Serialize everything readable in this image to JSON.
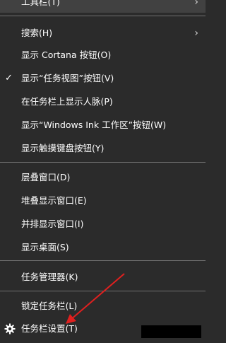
{
  "menu": {
    "items": [
      {
        "label": "工具栏(T)",
        "submenu": true
      },
      {
        "label": "搜索(H)",
        "submenu": true
      },
      {
        "label": "显示 Cortana 按钮(O)"
      },
      {
        "label": "显示“任务视图”按钮(V)",
        "checked": true
      },
      {
        "label": "在任务栏上显示人脉(P)"
      },
      {
        "label": "显示“Windows Ink 工作区”按钮(W)"
      },
      {
        "label": "显示触摸键盘按钮(Y)"
      },
      {
        "label": "层叠窗口(D)"
      },
      {
        "label": "堆叠显示窗口(E)"
      },
      {
        "label": "并排显示窗口(I)"
      },
      {
        "label": "显示桌面(S)"
      },
      {
        "label": "任务管理器(K)"
      },
      {
        "label": "锁定任务栏(L)"
      },
      {
        "label": "任务栏设置(T)",
        "icon": "gear-icon"
      }
    ],
    "chevron_glyph": "›",
    "check_glyph": "✓"
  },
  "colors": {
    "background": "#2b2b2b",
    "text": "#ffffff",
    "separator": "#707070",
    "annotation_arrow": "#e0201f",
    "redaction": "#000000"
  }
}
